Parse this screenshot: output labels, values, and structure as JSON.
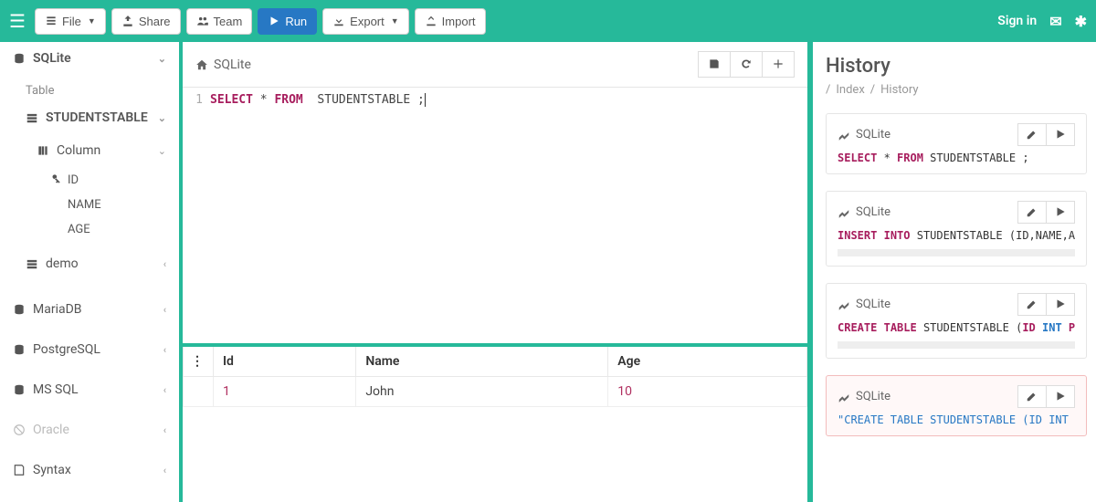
{
  "toolbar": {
    "file": "File",
    "share": "Share",
    "team": "Team",
    "run": "Run",
    "export": "Export",
    "import": "Import",
    "signin": "Sign in"
  },
  "sidebar": {
    "db_active": "SQLite",
    "table_label": "Table",
    "tables": [
      "STUDENTSTABLE"
    ],
    "column_label": "Column",
    "columns": [
      "ID",
      "NAME",
      "AGE"
    ],
    "demo": "demo",
    "other_dbs": [
      "MariaDB",
      "PostgreSQL",
      "MS SQL"
    ],
    "disabled_db": "Oracle",
    "syntax": "Syntax"
  },
  "editor": {
    "crumb": "SQLite",
    "line_no": "1",
    "sql_kw1": "SELECT",
    "sql_star": " * ",
    "sql_kw2": "FROM",
    "sql_rest": "  STUDENTSTABLE ;"
  },
  "results": {
    "headers": [
      "Id",
      "Name",
      "Age"
    ],
    "rows": [
      {
        "id": "1",
        "name": "John",
        "age": "10"
      }
    ]
  },
  "history": {
    "title": "History",
    "bc1": "Index",
    "bc2": "History",
    "items": [
      {
        "db": "SQLite",
        "sql_parts": [
          {
            "t": "kw",
            "v": "SELECT"
          },
          {
            "t": "",
            "v": " * "
          },
          {
            "t": "kw",
            "v": "FROM"
          },
          {
            "t": "",
            "v": "  STUDENTSTABLE ;"
          }
        ],
        "bar": false,
        "err": false
      },
      {
        "db": "SQLite",
        "sql_parts": [
          {
            "t": "kw",
            "v": "INSERT"
          },
          {
            "t": "",
            "v": " "
          },
          {
            "t": "kw",
            "v": "INTO"
          },
          {
            "t": "",
            "v": "  STUDENTSTABLE (ID,NAME,AG"
          }
        ],
        "bar": true,
        "err": false
      },
      {
        "db": "SQLite",
        "sql_parts": [
          {
            "t": "kw",
            "v": "CREATE"
          },
          {
            "t": "",
            "v": " "
          },
          {
            "t": "kw",
            "v": "TABLE"
          },
          {
            "t": "",
            "v": " STUDENTSTABLE ("
          },
          {
            "t": "kw",
            "v": "ID"
          },
          {
            "t": "",
            "v": " "
          },
          {
            "t": "ty",
            "v": "INT"
          },
          {
            "t": "",
            "v": " "
          },
          {
            "t": "kw",
            "v": "PRI"
          }
        ],
        "bar": true,
        "err": false
      },
      {
        "db": "SQLite",
        "sql_parts": [
          {
            "t": "str",
            "v": "\"CREATE TABLE STUDENTSTABLE (ID INT P"
          }
        ],
        "bar": false,
        "err": true
      }
    ]
  }
}
